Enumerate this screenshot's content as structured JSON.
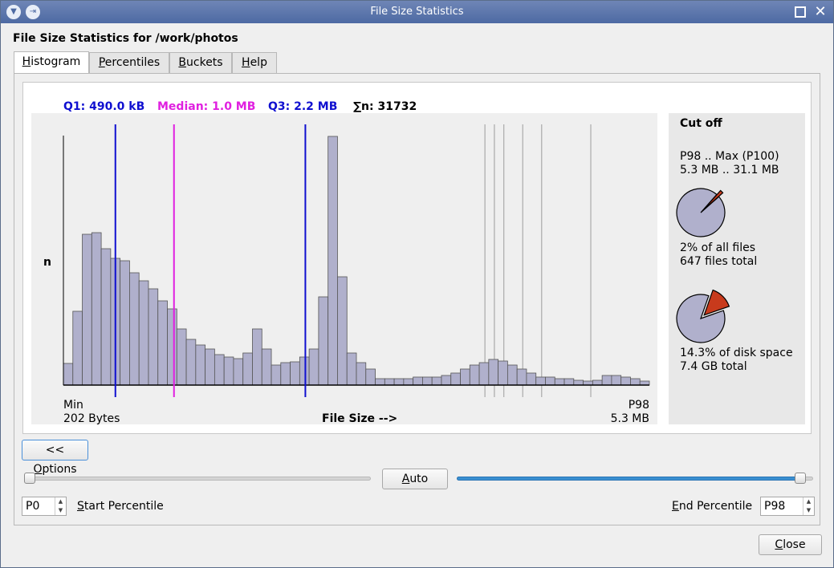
{
  "window": {
    "title": "File Size Statistics"
  },
  "heading": "File Size Statistics for /work/photos",
  "tabs": [
    {
      "label": "Histogram",
      "mnemonic": "H",
      "rest": "istogram"
    },
    {
      "label": "Percentiles",
      "mnemonic": "P",
      "rest": "ercentiles"
    },
    {
      "label": "Buckets",
      "mnemonic": "B",
      "rest": "uckets"
    },
    {
      "label": "Help",
      "mnemonic": "H",
      "rest": "elp"
    }
  ],
  "stats": {
    "q1": "Q1: 490.0 kB",
    "median": "Median: 1.0 MB",
    "q3": "Q3: 2.2 MB",
    "sum": "∑n: 31732"
  },
  "colors": {
    "q1": "#1010d0",
    "median": "#e020e0",
    "q3": "#1010d0",
    "bar_fill": "#b0b0cc",
    "pie_fill": "#b0b0cc",
    "pie_cut": "#c83a1c"
  },
  "chart_data": {
    "type": "bar",
    "ylabel": "n",
    "xlabel": "File Size  -->",
    "x_min_label": "Min",
    "x_min_value": "202 Bytes",
    "x_max_label": "P98",
    "x_max_value": "5.3 MB",
    "bar_count": 61,
    "values": [
      27,
      92,
      188,
      190,
      170,
      158,
      155,
      140,
      130,
      120,
      105,
      95,
      70,
      57,
      50,
      45,
      38,
      35,
      33,
      40,
      70,
      45,
      25,
      28,
      29,
      35,
      45,
      110,
      310,
      135,
      40,
      28,
      20,
      8,
      8,
      8,
      8,
      10,
      10,
      10,
      12,
      15,
      20,
      25,
      28,
      32,
      30,
      25,
      20,
      15,
      10,
      10,
      8,
      8,
      6,
      5,
      6,
      12,
      12,
      10,
      8,
      5
    ],
    "markers": [
      {
        "name": "Q1",
        "bar_position": 5.5,
        "color": "#1010d0"
      },
      {
        "name": "Median",
        "bar_position": 11.7,
        "color": "#e020e0"
      },
      {
        "name": "Q3",
        "bar_position": 25.6,
        "color": "#1010d0"
      }
    ],
    "percentile_lines": [
      44.6,
      45.6,
      46.6,
      48.6,
      50.6,
      55.8
    ]
  },
  "cutoff": {
    "title": "Cut off",
    "range_label": "P98 .. Max (P100)",
    "range_value": "5.3 MB .. 31.1 MB",
    "files_pct": "2% of all files",
    "files_total": "647 files total",
    "files_fraction": 0.02,
    "space_pct": "14.3% of disk space",
    "space_total": "7.4 GB total",
    "space_fraction": 0.143
  },
  "options_button": {
    "prefix": "<< ",
    "mnemonic": "O",
    "rest": "ptions"
  },
  "auto_button": {
    "mnemonic": "A",
    "rest": "uto"
  },
  "start_slider": {
    "value": 0
  },
  "end_slider": {
    "value": 98
  },
  "start_spin": {
    "value": "P0",
    "label_mnemonic": "S",
    "label_rest": "tart Percentile"
  },
  "end_spin": {
    "value": "P98",
    "label_mnemonic": "E",
    "label_rest": "nd Percentile"
  },
  "close_button": {
    "mnemonic": "C",
    "rest": "lose"
  }
}
